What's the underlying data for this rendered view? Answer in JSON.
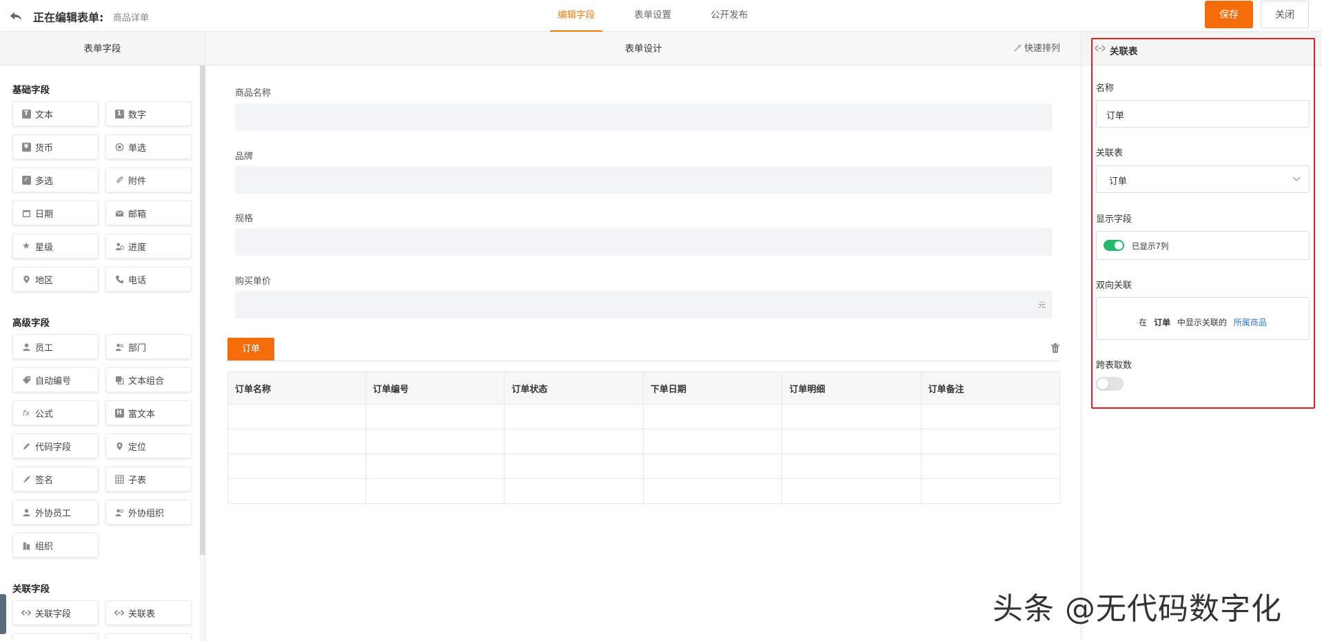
{
  "header": {
    "title": "正在编辑表单:",
    "subtitle": "商品详单",
    "tabs": [
      {
        "label": "编辑字段",
        "active": true
      },
      {
        "label": "表单设置",
        "active": false
      },
      {
        "label": "公开发布",
        "active": false
      }
    ],
    "save_label": "保存",
    "close_label": "关闭"
  },
  "left_panel": {
    "title": "表单字段",
    "groups": [
      {
        "title": "基础字段",
        "items": [
          {
            "label": "文本",
            "icon": "text-icon"
          },
          {
            "label": "数字",
            "icon": "number-icon"
          },
          {
            "label": "货币",
            "icon": "currency-icon"
          },
          {
            "label": "单选",
            "icon": "radio-icon"
          },
          {
            "label": "多选",
            "icon": "checkbox-icon"
          },
          {
            "label": "附件",
            "icon": "paperclip-icon"
          },
          {
            "label": "日期",
            "icon": "calendar-icon"
          },
          {
            "label": "邮箱",
            "icon": "mail-icon"
          },
          {
            "label": "星级",
            "icon": "star-icon"
          },
          {
            "label": "进度",
            "icon": "progress-icon"
          },
          {
            "label": "地区",
            "icon": "location-pin-icon"
          },
          {
            "label": "电话",
            "icon": "phone-icon"
          }
        ]
      },
      {
        "title": "高级字段",
        "items": [
          {
            "label": "员工",
            "icon": "user-icon"
          },
          {
            "label": "部门",
            "icon": "users-icon"
          },
          {
            "label": "自动编号",
            "icon": "tag-icon"
          },
          {
            "label": "文本组合",
            "icon": "text-combine-icon"
          },
          {
            "label": "公式",
            "icon": "formula-icon"
          },
          {
            "label": "富文本",
            "icon": "rich-text-icon"
          },
          {
            "label": "代码字段",
            "icon": "code-pen-icon"
          },
          {
            "label": "定位",
            "icon": "map-marker-icon"
          },
          {
            "label": "签名",
            "icon": "signature-icon"
          },
          {
            "label": "子表",
            "icon": "grid-table-icon"
          },
          {
            "label": "外协员工",
            "icon": "external-user-icon"
          },
          {
            "label": "外协组织",
            "icon": "external-users-icon"
          },
          {
            "label": "组织",
            "icon": "building-icon"
          }
        ]
      },
      {
        "title": "关联字段",
        "items": [
          {
            "label": "关联字段",
            "icon": "link-icon"
          },
          {
            "label": "关联表",
            "icon": "link-icon"
          }
        ]
      }
    ]
  },
  "center_panel": {
    "title": "表单设计",
    "quick_sort_label": "快速排列",
    "fields": [
      {
        "label": "商品名称",
        "suffix": ""
      },
      {
        "label": "品牌",
        "suffix": ""
      },
      {
        "label": "规格",
        "suffix": ""
      },
      {
        "label": "购买单价",
        "suffix": "元"
      }
    ],
    "subtable": {
      "tab_label": "订单",
      "columns": [
        "订单名称",
        "订单编号",
        "订单状态",
        "下单日期",
        "订单明细",
        "订单备注"
      ],
      "empty_rows": 4
    }
  },
  "right_panel": {
    "title": "关联表",
    "name_label": "名称",
    "name_value": "订单",
    "table_label": "关联表",
    "table_value": "订单",
    "display_label": "显示字段",
    "display_toggle_on": true,
    "display_text": "已显示7列",
    "bidirectional_label": "双向关联",
    "bi_prefix": "在",
    "bi_table": "订单",
    "bi_middle": "中显示关联的",
    "bi_link": "所属商品",
    "cross_label": "跨表取数",
    "cross_toggle_on": false
  },
  "watermark": "头条 @无代码数字化",
  "colors": {
    "accent": "#f56d0a",
    "toggle_on": "#22b96a",
    "link": "#2a79d7",
    "highlight_frame": "#e02020"
  }
}
